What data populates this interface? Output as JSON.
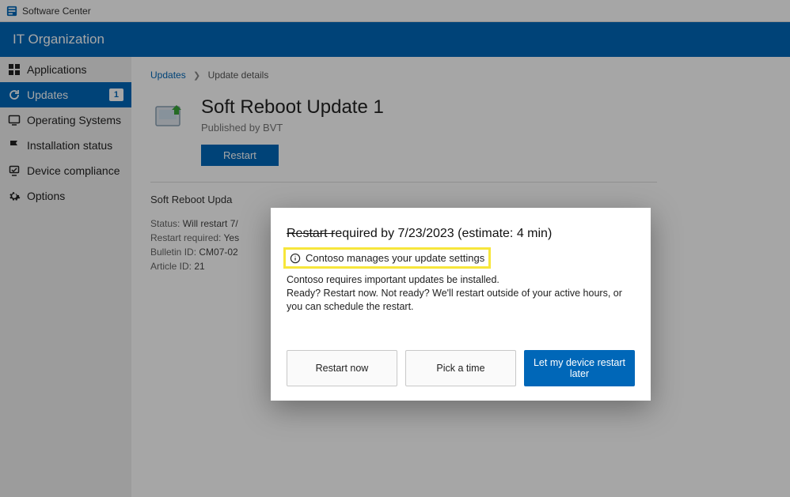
{
  "window_title": "Software Center",
  "org_banner": "IT Organization",
  "sidebar": {
    "items": [
      {
        "label": "Applications"
      },
      {
        "label": "Updates",
        "badge": "1",
        "active": true
      },
      {
        "label": "Operating Systems"
      },
      {
        "label": "Installation status"
      },
      {
        "label": "Device compliance"
      },
      {
        "label": "Options"
      }
    ]
  },
  "breadcrumb": {
    "parent": "Updates",
    "current": "Update details"
  },
  "update": {
    "title": "Soft Reboot Update 1",
    "published_by": "Published by BVT",
    "restart_label": "Restart",
    "description": "Soft Reboot Upda",
    "status_label": "Status:",
    "status_value": "Will restart 7/",
    "restart_required_label": "Restart required:",
    "restart_required_value": "Yes",
    "bulletin_label": "Bulletin ID:",
    "bulletin_value": "CM07-02",
    "article_label": "Article ID:",
    "article_value": "21"
  },
  "dialog": {
    "heading_leading": "Restart r",
    "heading_rest": "equired by 7/23/2023 (estimate: 4 min)",
    "sub": "Contoso manages your update settings",
    "body1": "Contoso requires important updates be installed.",
    "body2": "Ready? Restart now. Not ready? We'll restart outside of your active hours, or you can schedule the restart.",
    "btn_restart_now": "Restart now",
    "btn_pick_time": "Pick a time",
    "btn_later": "Let my device restart later"
  }
}
